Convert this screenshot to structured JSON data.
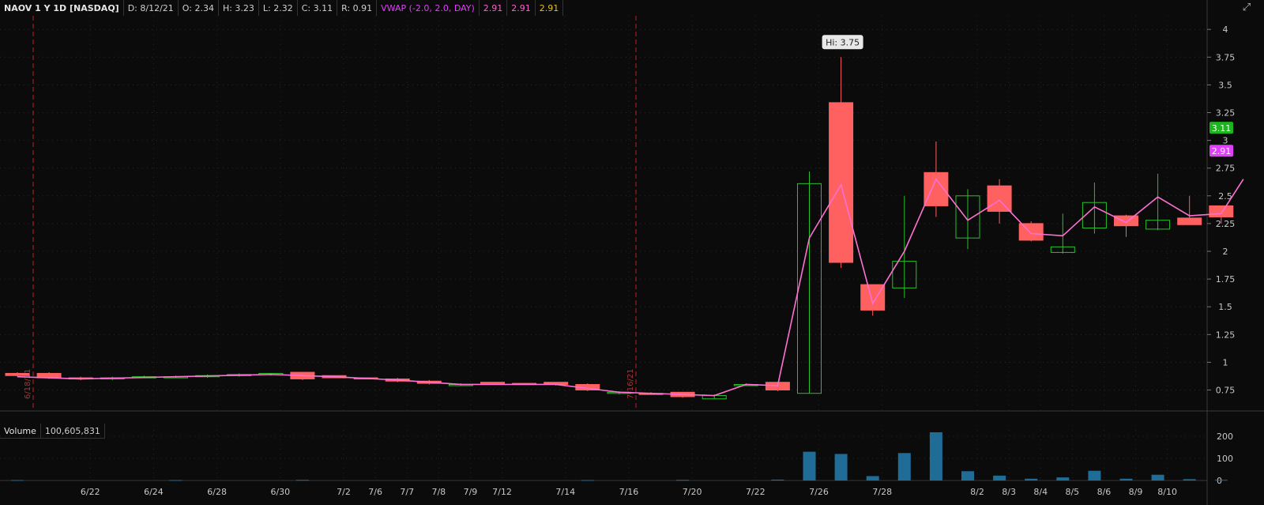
{
  "header": {
    "title": "NAOV 1 Y 1D [NASDAQ]",
    "date": "D: 8/12/21",
    "open": "O: 2.34",
    "high": "H: 3.23",
    "low": "L: 2.32",
    "close": "C: 3.11",
    "range": "R: 0.91",
    "vwap_label": "VWAP (-2.0, 2.0, DAY)",
    "vwap_values": [
      "2.91",
      "2.91",
      "2.91"
    ]
  },
  "volume_pane": {
    "label": "Volume",
    "total": "100,605,831"
  },
  "chart_data": {
    "type": "candlestick",
    "colors": {
      "up": "#27c12a",
      "down": "#ff6060",
      "vwap": "#ff70d2",
      "volume": "#1f6c96",
      "last_badge": "#1db51d",
      "vwap_badge": "#e040fb"
    },
    "y_ticks": [
      "0.75",
      "1",
      "1.25",
      "1.5",
      "1.75",
      "2",
      "2.25",
      "2.5",
      "2.75",
      "3",
      "3.25",
      "3.5",
      "3.75",
      "4"
    ],
    "volume_ticks": [
      "0",
      "100",
      "200"
    ],
    "x_labels": [
      "6/22",
      "6/24",
      "6/28",
      "6/30",
      "7/2",
      "7/6",
      "7/7",
      "7/8",
      "7/9",
      "7/12",
      "7/14",
      "7/16",
      "7/20",
      "7/22",
      "7/26",
      "7/28",
      "8/2",
      "8/3",
      "8/4",
      "8/5",
      "8/6",
      "8/9",
      "8/10"
    ],
    "markers": [
      "6/18/21",
      "7/16/21"
    ],
    "hi_label": "Hi: 3.75",
    "last_price": "3.11",
    "vwap_price": "2.91",
    "candles": [
      {
        "x": 0,
        "o": 0.9,
        "h": 0.91,
        "l": 0.87,
        "c": 0.88
      },
      {
        "x": 1,
        "o": 0.9,
        "h": 0.91,
        "l": 0.85,
        "c": 0.86
      },
      {
        "x": 2,
        "o": 0.86,
        "h": 0.87,
        "l": 0.84,
        "c": 0.85
      },
      {
        "x": 3,
        "o": 0.85,
        "h": 0.87,
        "l": 0.84,
        "c": 0.86
      },
      {
        "x": 4,
        "o": 0.86,
        "h": 0.88,
        "l": 0.86,
        "c": 0.87
      },
      {
        "x": 5,
        "o": 0.87,
        "h": 0.88,
        "l": 0.86,
        "c": 0.87
      },
      {
        "x": 6,
        "o": 0.87,
        "h": 0.89,
        "l": 0.86,
        "c": 0.88
      },
      {
        "x": 7,
        "o": 0.88,
        "h": 0.9,
        "l": 0.87,
        "c": 0.89
      },
      {
        "x": 8,
        "o": 0.89,
        "h": 0.9,
        "l": 0.88,
        "c": 0.9
      },
      {
        "x": 9,
        "o": 0.91,
        "h": 0.91,
        "l": 0.84,
        "c": 0.85
      },
      {
        "x": 10,
        "o": 0.88,
        "h": 0.88,
        "l": 0.86,
        "c": 0.86
      },
      {
        "x": 11,
        "o": 0.86,
        "h": 0.86,
        "l": 0.85,
        "c": 0.85
      },
      {
        "x": 12,
        "o": 0.85,
        "h": 0.86,
        "l": 0.82,
        "c": 0.83
      },
      {
        "x": 13,
        "o": 0.83,
        "h": 0.84,
        "l": 0.8,
        "c": 0.81
      },
      {
        "x": 14,
        "o": 0.8,
        "h": 0.81,
        "l": 0.79,
        "c": 0.8
      },
      {
        "x": 15,
        "o": 0.82,
        "h": 0.82,
        "l": 0.8,
        "c": 0.81
      },
      {
        "x": 16,
        "o": 0.81,
        "h": 0.81,
        "l": 0.8,
        "c": 0.8
      },
      {
        "x": 17,
        "o": 0.82,
        "h": 0.82,
        "l": 0.79,
        "c": 0.8
      },
      {
        "x": 18,
        "o": 0.8,
        "h": 0.81,
        "l": 0.74,
        "c": 0.75
      },
      {
        "x": 19,
        "o": 0.72,
        "h": 0.74,
        "l": 0.71,
        "c": 0.73
      },
      {
        "x": 20,
        "o": 0.72,
        "h": 0.73,
        "l": 0.71,
        "c": 0.71
      },
      {
        "x": 21,
        "o": 0.73,
        "h": 0.73,
        "l": 0.68,
        "c": 0.69
      },
      {
        "x": 22,
        "o": 0.67,
        "h": 0.71,
        "l": 0.67,
        "c": 0.7
      },
      {
        "x": 23,
        "o": 0.79,
        "h": 0.81,
        "l": 0.79,
        "c": 0.8
      },
      {
        "x": 24,
        "o": 0.82,
        "h": 0.82,
        "l": 0.74,
        "c": 0.75
      },
      {
        "x": 25,
        "o": 0.72,
        "h": 2.72,
        "l": 0.72,
        "c": 2.61
      },
      {
        "x": 26,
        "o": 3.34,
        "h": 3.75,
        "l": 1.85,
        "c": 1.9
      },
      {
        "x": 27,
        "o": 1.7,
        "h": 1.7,
        "l": 1.42,
        "c": 1.47
      },
      {
        "x": 28,
        "o": 1.67,
        "h": 2.5,
        "l": 1.58,
        "c": 1.91
      },
      {
        "x": 29,
        "o": 2.71,
        "h": 2.99,
        "l": 2.31,
        "c": 2.41
      },
      {
        "x": 30,
        "o": 2.12,
        "h": 2.56,
        "l": 2.02,
        "c": 2.5
      },
      {
        "x": 31,
        "o": 2.59,
        "h": 2.65,
        "l": 2.25,
        "c": 2.36
      },
      {
        "x": 32,
        "o": 2.25,
        "h": 2.27,
        "l": 2.09,
        "c": 2.1
      },
      {
        "x": 33,
        "o": 1.99,
        "h": 2.34,
        "l": 1.98,
        "c": 2.04
      },
      {
        "x": 34,
        "o": 2.21,
        "h": 2.62,
        "l": 2.16,
        "c": 2.44
      },
      {
        "x": 35,
        "o": 2.32,
        "h": 2.33,
        "l": 2.13,
        "c": 2.23
      },
      {
        "x": 36,
        "o": 2.2,
        "h": 2.7,
        "l": 2.19,
        "c": 2.28
      },
      {
        "x": 37,
        "o": 2.3,
        "h": 2.5,
        "l": 2.24,
        "c": 2.24
      },
      {
        "x": 38,
        "o": 2.41,
        "h": 2.41,
        "l": 2.25,
        "c": 2.31
      }
    ],
    "vwap": [
      {
        "x": 0,
        "v": 0.87
      },
      {
        "x": 2,
        "v": 0.85
      },
      {
        "x": 5,
        "v": 0.87
      },
      {
        "x": 8,
        "v": 0.89
      },
      {
        "x": 10,
        "v": 0.87
      },
      {
        "x": 12,
        "v": 0.84
      },
      {
        "x": 14,
        "v": 0.8
      },
      {
        "x": 17,
        "v": 0.8
      },
      {
        "x": 19,
        "v": 0.73
      },
      {
        "x": 21,
        "v": 0.71
      },
      {
        "x": 22,
        "v": 0.7
      },
      {
        "x": 23,
        "v": 0.8
      },
      {
        "x": 24,
        "v": 0.79
      },
      {
        "x": 25,
        "v": 2.12
      },
      {
        "x": 26,
        "v": 2.6
      },
      {
        "x": 27,
        "v": 1.53
      },
      {
        "x": 28,
        "v": 2.0
      },
      {
        "x": 29,
        "v": 2.65
      },
      {
        "x": 30,
        "v": 2.28
      },
      {
        "x": 31,
        "v": 2.46
      },
      {
        "x": 32,
        "v": 2.16
      },
      {
        "x": 33,
        "v": 2.14
      },
      {
        "x": 34,
        "v": 2.4
      },
      {
        "x": 35,
        "v": 2.26
      },
      {
        "x": 36,
        "v": 2.49
      },
      {
        "x": 37,
        "v": 2.32
      },
      {
        "x": 38,
        "v": 2.34
      },
      {
        "x": 38.7,
        "v": 2.65
      }
    ],
    "volume": [
      {
        "x": 25,
        "v": 130
      },
      {
        "x": 26,
        "v": 120
      },
      {
        "x": 27,
        "v": 20
      },
      {
        "x": 28,
        "v": 124
      },
      {
        "x": 29,
        "v": 218
      },
      {
        "x": 30,
        "v": 42
      },
      {
        "x": 31,
        "v": 22
      },
      {
        "x": 32,
        "v": 8
      },
      {
        "x": 33,
        "v": 14
      },
      {
        "x": 34,
        "v": 44
      },
      {
        "x": 35,
        "v": 8
      },
      {
        "x": 36,
        "v": 26
      },
      {
        "x": 37,
        "v": 6
      },
      {
        "x": 38,
        "v": 3
      },
      {
        "x": 0,
        "v": 2
      },
      {
        "x": 5,
        "v": 2
      },
      {
        "x": 9,
        "v": 3
      },
      {
        "x": 18,
        "v": 2
      },
      {
        "x": 21,
        "v": 3
      },
      {
        "x": 24,
        "v": 4
      }
    ]
  }
}
